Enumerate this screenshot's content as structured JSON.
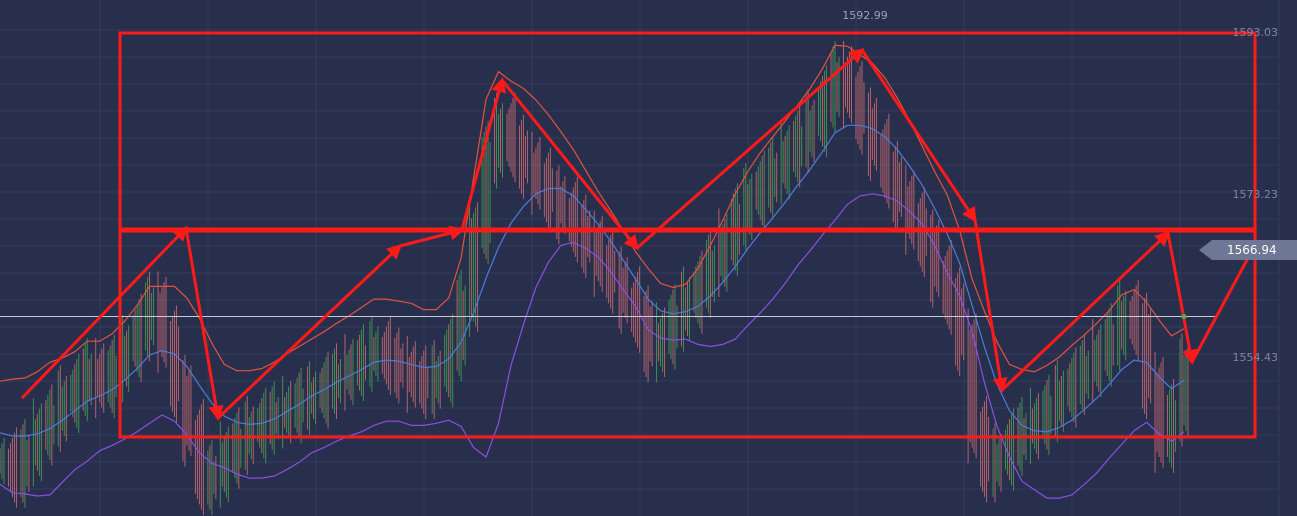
{
  "colors": {
    "background": "#272f4d",
    "grid": "#323b5c",
    "up_bar": "#4caf50",
    "down_bar": "#e57373",
    "upper_band": "#e0533f",
    "middle_band": "#4f7bd8",
    "lower_band": "#8a4fe0",
    "annotation": "#ff1a1a",
    "current_price_line": "#c8cbd6",
    "price_tag": "#6e7793"
  },
  "chart_data": {
    "type": "line",
    "title": "",
    "xlabel": "",
    "ylabel": "",
    "ylim": [
      1548,
      1597
    ],
    "y_ticks": [
      "1593.03",
      "1573.23",
      "1554.43"
    ],
    "peak_label": "1592.99",
    "current_price": "1566.94",
    "current_price_value": 1566.94,
    "grid": true,
    "series": [
      {
        "name": "",
        "role": "close",
        "values": [
          1553.2,
          1552.0,
          1554.0,
          1556.0,
          1557.3,
          1559.1,
          1560.2,
          1561.7,
          1560.5,
          1562.0,
          1563.9,
          1565.9,
          1568.0,
          1564.8,
          1560.1,
          1555.9,
          1551.3,
          1552.0,
          1553.8,
          1555.1,
          1556.2,
          1557.0,
          1557.6,
          1558.1,
          1558.9,
          1559.5,
          1560.4,
          1561.2,
          1562.1,
          1563.0,
          1563.8,
          1562.7,
          1561.9,
          1561.0,
          1560.4,
          1561.5,
          1564.0,
          1568.2,
          1575.1,
          1582.3,
          1585.0,
          1582.9,
          1581.3,
          1579.8,
          1578.1,
          1577.0,
          1575.3,
          1573.8,
          1572.0,
          1570.4,
          1568.5,
          1566.7,
          1563.9,
          1565.1,
          1566.8,
          1568.5,
          1570.0,
          1572.0,
          1574.0,
          1576.4,
          1578.3,
          1579.5,
          1580.8,
          1582.4,
          1583.8,
          1585.3,
          1587.6,
          1589.9,
          1588.0,
          1585.5,
          1583.0,
          1580.4,
          1578.1,
          1576.0,
          1573.9,
          1571.0,
          1568.4,
          1564.5,
          1556.2,
          1552.5,
          1553.6,
          1555.0,
          1556.1,
          1557.0,
          1558.2,
          1559.6,
          1560.8,
          1562.0,
          1563.5,
          1565.0,
          1567.2,
          1566.0,
          1560.4,
          1555.3,
          1557.8,
          1562.1
        ]
      },
      {
        "name": "",
        "role": "upper-band",
        "values": [
          1560.8,
          1561.0,
          1561.1,
          1561.7,
          1562.6,
          1563.0,
          1563.6,
          1564.6,
          1564.6,
          1565.3,
          1566.5,
          1568.0,
          1569.8,
          1569.8,
          1569.8,
          1568.7,
          1566.8,
          1564.4,
          1562.4,
          1561.8,
          1561.8,
          1562.0,
          1562.6,
          1563.4,
          1564.1,
          1564.8,
          1565.5,
          1566.3,
          1567.0,
          1567.8,
          1568.6,
          1568.6,
          1568.4,
          1568.2,
          1567.6,
          1567.6,
          1568.7,
          1572.5,
          1580.1,
          1587.6,
          1590.2,
          1589.3,
          1588.6,
          1587.5,
          1586.1,
          1584.5,
          1582.8,
          1580.8,
          1578.8,
          1577.0,
          1575.1,
          1573.1,
          1571.5,
          1570.1,
          1569.7,
          1570.0,
          1571.5,
          1573.7,
          1576.1,
          1578.6,
          1580.7,
          1582.5,
          1584.0,
          1585.5,
          1587.0,
          1588.6,
          1590.5,
          1592.7,
          1592.6,
          1591.8,
          1591.0,
          1589.6,
          1587.7,
          1585.5,
          1583.1,
          1580.7,
          1578.5,
          1575.1,
          1570.5,
          1567.4,
          1564.5,
          1562.4,
          1561.9,
          1561.7,
          1562.3,
          1563.1,
          1564.2,
          1565.2,
          1566.3,
          1567.5,
          1569.0,
          1569.5,
          1568.3,
          1566.6,
          1565.1,
          1565.8
        ]
      },
      {
        "name": "",
        "role": "middle-band",
        "values": [
          1555.9,
          1555.6,
          1555.6,
          1555.8,
          1556.3,
          1557.1,
          1558.0,
          1558.9,
          1559.4,
          1560.0,
          1560.9,
          1562.0,
          1563.3,
          1563.7,
          1563.4,
          1562.2,
          1560.4,
          1558.7,
          1557.5,
          1556.9,
          1556.7,
          1556.8,
          1557.2,
          1557.9,
          1558.6,
          1559.4,
          1560.0,
          1560.7,
          1561.3,
          1561.9,
          1562.6,
          1562.8,
          1562.7,
          1562.4,
          1562.1,
          1562.2,
          1562.9,
          1564.5,
          1567.3,
          1570.6,
          1573.5,
          1575.8,
          1577.4,
          1578.6,
          1579.1,
          1579.1,
          1578.4,
          1577.1,
          1575.7,
          1574.1,
          1572.3,
          1570.5,
          1568.6,
          1567.5,
          1567.2,
          1567.4,
          1567.9,
          1568.9,
          1570.2,
          1571.7,
          1573.4,
          1574.9,
          1576.3,
          1577.8,
          1579.4,
          1580.9,
          1582.6,
          1584.4,
          1585.1,
          1585.1,
          1584.8,
          1584.0,
          1582.8,
          1581.2,
          1579.4,
          1577.2,
          1574.8,
          1572.0,
          1568.0,
          1564.0,
          1560.5,
          1558.0,
          1556.6,
          1556.1,
          1556.0,
          1556.4,
          1557.1,
          1558.1,
          1559.2,
          1560.5,
          1561.9,
          1562.8,
          1562.6,
          1561.2,
          1560.1,
          1560.9
        ]
      },
      {
        "name": "",
        "role": "lower-band",
        "values": [
          1551.0,
          1550.2,
          1550.1,
          1549.9,
          1550.0,
          1551.2,
          1552.4,
          1553.2,
          1554.2,
          1554.7,
          1555.3,
          1556.0,
          1556.8,
          1557.6,
          1557.0,
          1555.7,
          1554.0,
          1553.0,
          1552.6,
          1552.0,
          1551.6,
          1551.6,
          1551.8,
          1552.4,
          1553.1,
          1554.0,
          1554.5,
          1555.1,
          1555.6,
          1556.0,
          1556.6,
          1557.0,
          1557.0,
          1556.6,
          1556.6,
          1556.8,
          1557.1,
          1556.5,
          1554.5,
          1553.6,
          1556.8,
          1562.3,
          1566.2,
          1569.7,
          1572.1,
          1573.7,
          1574.0,
          1573.4,
          1572.6,
          1571.2,
          1569.5,
          1567.9,
          1565.7,
          1564.9,
          1564.7,
          1564.8,
          1564.3,
          1564.1,
          1564.3,
          1564.8,
          1566.1,
          1567.3,
          1568.6,
          1570.1,
          1571.8,
          1573.2,
          1574.7,
          1576.1,
          1577.6,
          1578.4,
          1578.6,
          1578.4,
          1577.9,
          1576.9,
          1575.7,
          1573.7,
          1571.1,
          1568.9,
          1565.5,
          1560.6,
          1556.5,
          1553.6,
          1551.3,
          1550.5,
          1549.7,
          1549.7,
          1550.0,
          1551.0,
          1552.1,
          1553.5,
          1554.8,
          1556.1,
          1556.9,
          1555.8,
          1555.1,
          1556.0
        ]
      }
    ]
  }
}
